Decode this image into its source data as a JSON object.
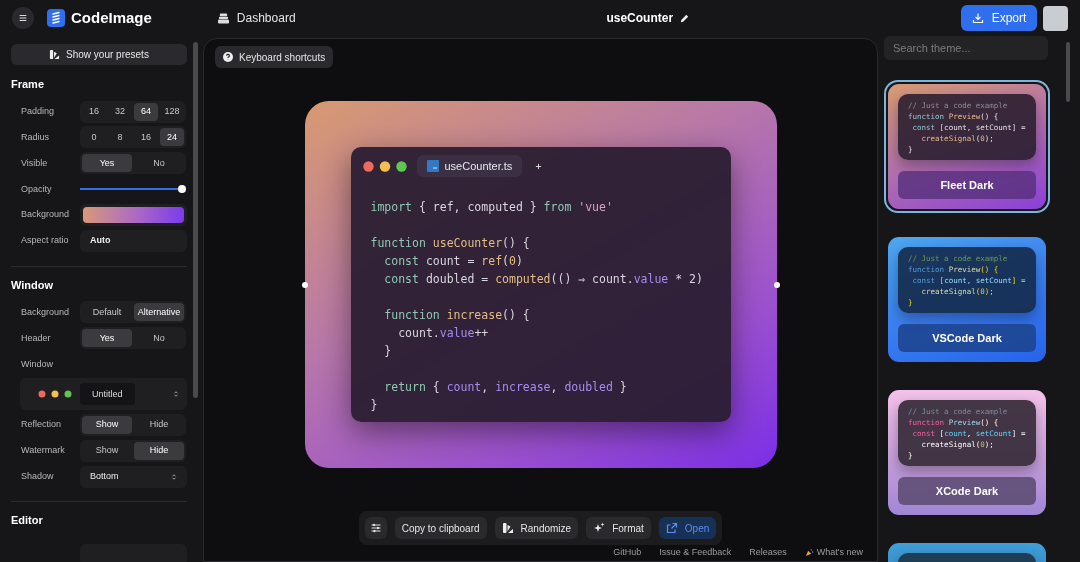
{
  "header": {
    "app_name": "CodeImage",
    "nav_label": "Dashboard",
    "title": "useCounter",
    "export_label": "Export"
  },
  "sidebar": {
    "presets_button": "Show your presets",
    "sections": [
      {
        "title": "Frame",
        "rows": [
          {
            "kind": "segmented",
            "label": "Padding",
            "options": [
              {
                "label": "16",
                "selected": false
              },
              {
                "label": "32",
                "selected": false
              },
              {
                "label": "64",
                "selected": true
              },
              {
                "label": "128",
                "selected": false
              }
            ]
          },
          {
            "kind": "segmented",
            "label": "Radius",
            "options": [
              {
                "label": "0",
                "selected": false
              },
              {
                "label": "8",
                "selected": false
              },
              {
                "label": "16",
                "selected": false
              },
              {
                "label": "24",
                "selected": true
              }
            ]
          },
          {
            "kind": "segmented",
            "label": "Visible",
            "options": [
              {
                "label": "Yes",
                "selected": true
              },
              {
                "label": "No",
                "selected": false
              }
            ]
          },
          {
            "kind": "slider",
            "label": "Opacity",
            "level": 1
          },
          {
            "kind": "gradient",
            "label": "Background"
          },
          {
            "kind": "field",
            "label": "Aspect ratio",
            "value": "Auto"
          }
        ]
      },
      {
        "title": "Window",
        "rows": [
          {
            "kind": "segmented",
            "label": "Background",
            "options": [
              {
                "label": "Default",
                "selected": false
              },
              {
                "label": "Alternative",
                "selected": true
              }
            ]
          },
          {
            "kind": "segmented",
            "label": "Header",
            "options": [
              {
                "label": "Yes",
                "selected": true
              },
              {
                "label": "No",
                "selected": false
              }
            ]
          },
          {
            "kind": "heading",
            "label": "Window"
          },
          {
            "kind": "window_picker",
            "tab_label": "Untitled"
          },
          {
            "kind": "segmented",
            "label": "Reflection",
            "options": [
              {
                "label": "Show",
                "selected": true
              },
              {
                "label": "Hide",
                "selected": false
              }
            ]
          },
          {
            "kind": "segmented",
            "label": "Watermark",
            "options": [
              {
                "label": "Show",
                "selected": false
              },
              {
                "label": "Hide",
                "selected": true
              }
            ]
          },
          {
            "kind": "select",
            "label": "Shadow",
            "value": "Bottom"
          }
        ]
      },
      {
        "title": "Editor",
        "rows": [
          {
            "kind": "cut_control"
          }
        ]
      }
    ]
  },
  "canvas": {
    "shortcuts_button": "Keyboard shortcuts",
    "editor": {
      "tab": "useCounter.ts",
      "lines": [
        {
          "kind": "code",
          "tokens": [
            {
              "kind": "kw",
              "text": "import"
            },
            {
              "kind": "p",
              "text": " { ref, computed } "
            },
            {
              "kind": "kw",
              "text": "from"
            },
            {
              "kind": "str",
              "text": " 'vue'"
            }
          ]
        },
        {
          "kind": "blank"
        },
        {
          "kind": "code",
          "tokens": [
            {
              "kind": "kw",
              "text": "function"
            },
            {
              "kind": "fn",
              "text": " useCounter"
            },
            {
              "kind": "p",
              "text": "() {"
            }
          ]
        },
        {
          "kind": "code",
          "tokens": [
            {
              "kind": "kw",
              "text": "  const"
            },
            {
              "kind": "p",
              "text": " count = "
            },
            {
              "kind": "fn",
              "text": "ref"
            },
            {
              "kind": "p",
              "text": "("
            },
            {
              "kind": "num",
              "text": "0"
            },
            {
              "kind": "p",
              "text": ")"
            }
          ]
        },
        {
          "kind": "code",
          "tokens": [
            {
              "kind": "kw",
              "text": "  const"
            },
            {
              "kind": "p",
              "text": " doubled = "
            },
            {
              "kind": "fn",
              "text": "computed"
            },
            {
              "kind": "p",
              "text": "(() ⇒ count."
            },
            {
              "kind": "prop",
              "text": "value"
            },
            {
              "kind": "p",
              "text": " * 2)"
            }
          ]
        },
        {
          "kind": "blank"
        },
        {
          "kind": "code",
          "tokens": [
            {
              "kind": "kw",
              "text": "  function"
            },
            {
              "kind": "fn",
              "text": " increase"
            },
            {
              "kind": "p",
              "text": "() {"
            }
          ]
        },
        {
          "kind": "code",
          "tokens": [
            {
              "kind": "p",
              "text": "    count."
            },
            {
              "kind": "prop",
              "text": "value"
            },
            {
              "kind": "p",
              "text": "++"
            }
          ]
        },
        {
          "kind": "code",
          "tokens": [
            {
              "kind": "p",
              "text": "  }"
            }
          ]
        },
        {
          "kind": "blank"
        },
        {
          "kind": "code",
          "tokens": [
            {
              "kind": "kw",
              "text": "  return"
            },
            {
              "kind": "p",
              "text": " { "
            },
            {
              "kind": "prop",
              "text": "count"
            },
            {
              "kind": "p",
              "text": ", "
            },
            {
              "kind": "prop",
              "text": "increase"
            },
            {
              "kind": "p",
              "text": ", "
            },
            {
              "kind": "prop",
              "text": "doubled"
            },
            {
              "kind": "p",
              "text": " }"
            }
          ]
        },
        {
          "kind": "code",
          "tokens": [
            {
              "kind": "p",
              "text": "}"
            }
          ]
        }
      ]
    },
    "toolbar": [
      {
        "kind": "settings"
      },
      {
        "kind": "plain",
        "label": "Copy to clipboard"
      },
      {
        "kind": "randomize",
        "label": "Randomize"
      },
      {
        "kind": "format",
        "label": "Format"
      },
      {
        "kind": "open",
        "label": "Open"
      }
    ],
    "footer_links": [
      {
        "kind": "plain",
        "label": "GitHub"
      },
      {
        "kind": "plain",
        "label": "Issue & Feedback"
      },
      {
        "kind": "plain",
        "label": "Releases"
      },
      {
        "kind": "party",
        "label": "What's new"
      }
    ]
  },
  "themes": {
    "search_placeholder": "Search theme...",
    "items": [
      {
        "kind": "fleet",
        "name": "Fleet Dark",
        "selected": true,
        "preview": [
          [
            {
              "kind": "cm",
              "text": "// Just a code example"
            }
          ],
          [
            {
              "kind": "kw",
              "text": "function"
            },
            {
              "kind": "fn",
              "text": " Preview"
            },
            {
              "kind": "p",
              "text": "() {"
            }
          ],
          [
            {
              "kind": "kw",
              "text": " const"
            },
            {
              "kind": "p",
              "text": " [count, setCount] ="
            }
          ],
          [
            {
              "kind": "fn",
              "text": "   createSignal"
            },
            {
              "kind": "p",
              "text": "("
            },
            {
              "kind": "num",
              "text": "0"
            },
            {
              "kind": "p",
              "text": ");"
            }
          ],
          [
            {
              "kind": "p",
              "text": "}"
            }
          ]
        ]
      },
      {
        "kind": "vscode",
        "name": "VSCode Dark",
        "selected": false,
        "preview": [
          [
            {
              "kind": "cm",
              "text": "// Just a code example"
            }
          ],
          [
            {
              "kind": "kw",
              "text": "function"
            },
            {
              "kind": "fn",
              "text": " Preview"
            },
            {
              "kind": "br",
              "text": "() {"
            }
          ],
          [
            {
              "kind": "kw",
              "text": " const"
            },
            {
              "kind": "br",
              "text": " ["
            },
            {
              "kind": "var",
              "text": "count, setCount"
            },
            {
              "kind": "br",
              "text": "]"
            },
            {
              "kind": "p",
              "text": " ="
            }
          ],
          [
            {
              "kind": "fn",
              "text": "   createSignal"
            },
            {
              "kind": "br",
              "text": "("
            },
            {
              "kind": "num",
              "text": "0"
            },
            {
              "kind": "br",
              "text": ")"
            },
            {
              "kind": "p",
              "text": ";"
            }
          ],
          [
            {
              "kind": "br",
              "text": "}"
            }
          ]
        ]
      },
      {
        "kind": "xcode",
        "name": "XCode Dark",
        "selected": false,
        "preview": [
          [
            {
              "kind": "cm",
              "text": "// Just a code example"
            }
          ],
          [
            {
              "kind": "kw",
              "text": "function"
            },
            {
              "kind": "fn",
              "text": " Preview"
            },
            {
              "kind": "p",
              "text": "() {"
            }
          ],
          [
            {
              "kind": "kw",
              "text": " const"
            },
            {
              "kind": "p",
              "text": " ["
            },
            {
              "kind": "var",
              "text": "count"
            },
            {
              "kind": "p",
              "text": ", "
            },
            {
              "kind": "var",
              "text": "setCount"
            },
            {
              "kind": "p",
              "text": "] ="
            }
          ],
          [
            {
              "kind": "p",
              "text": "   createSignal("
            },
            {
              "kind": "num",
              "text": "0"
            },
            {
              "kind": "p",
              "text": ");"
            }
          ],
          [
            {
              "kind": "p",
              "text": "}"
            }
          ]
        ]
      },
      {
        "kind": "ocean",
        "selected": false
      }
    ]
  }
}
